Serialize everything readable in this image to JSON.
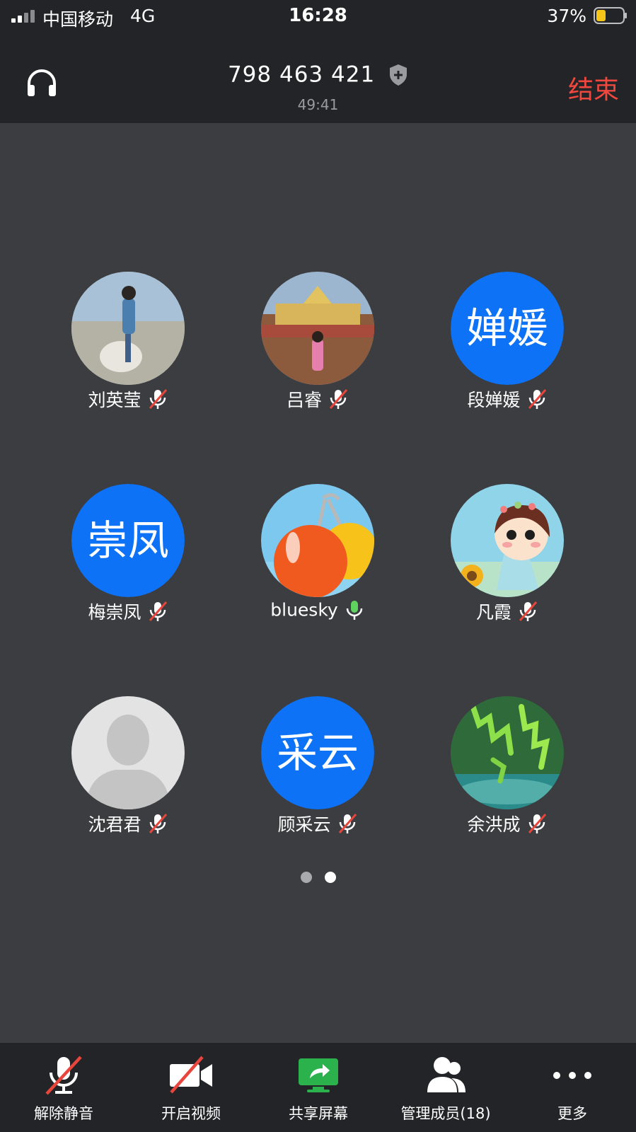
{
  "status_bar": {
    "carrier": "中国移动",
    "network": "4G",
    "time": "16:28",
    "battery": "37%"
  },
  "header": {
    "meeting_id": "798 463 421",
    "duration": "49:41",
    "end_label": "结束",
    "end_color": "#f0473f"
  },
  "participants": [
    {
      "name": "刘英莹",
      "avatar": "photo",
      "mic": "muted"
    },
    {
      "name": "吕睿",
      "avatar": "photo",
      "mic": "muted"
    },
    {
      "name": "段婵媛",
      "avatar_text": "婵媛",
      "mic": "muted"
    },
    {
      "name": "梅崇凤",
      "avatar_text": "崇凤",
      "mic": "muted"
    },
    {
      "name": "bluesky",
      "avatar": "photo",
      "mic": "active"
    },
    {
      "name": "凡霞",
      "avatar": "photo",
      "mic": "muted"
    },
    {
      "name": "沈君君",
      "avatar": "default-person",
      "mic": "muted"
    },
    {
      "name": "顾采云",
      "avatar_text": "采云",
      "mic": "muted"
    },
    {
      "name": "余洪成",
      "avatar": "photo",
      "mic": "muted"
    }
  ],
  "pagination": {
    "current": 2,
    "total": 2
  },
  "toolbar": {
    "unmute": "解除静音",
    "video": "开启视频",
    "share": "共享屏幕",
    "members": "管理成员(18)",
    "more": "更多"
  },
  "colors": {
    "accent_blue": "#0d72f5",
    "mic_active": "#5fd35f",
    "mute_slash": "#e8453c",
    "share_green": "#2bb24c"
  }
}
